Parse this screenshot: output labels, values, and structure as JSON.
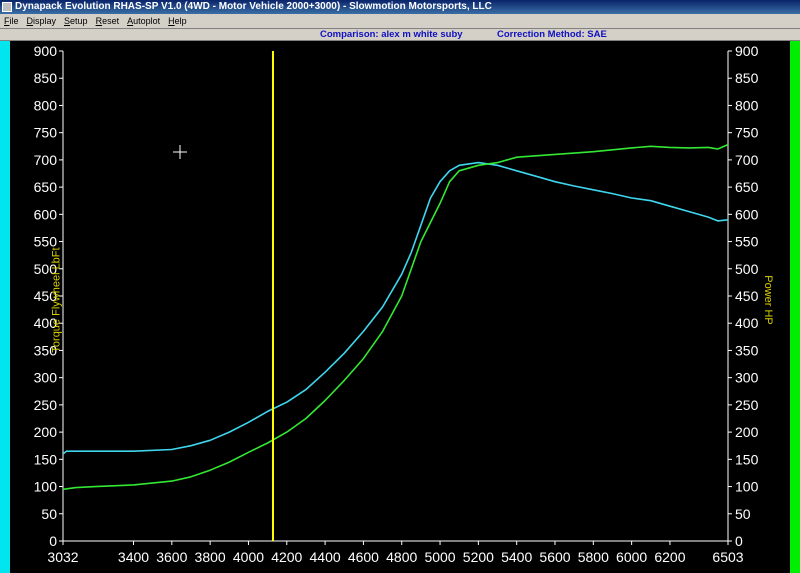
{
  "window": {
    "title": "Dynapack Evolution RHAS-SP V1.0  (4WD - Motor Vehicle 2000+3000) - Slowmotion Motorsports, LLC"
  },
  "menu": {
    "items": [
      "File",
      "Display",
      "Setup",
      "Reset",
      "Autoplot",
      "Help"
    ],
    "underline": [
      "F",
      "D",
      "S",
      "R",
      "A",
      "H"
    ]
  },
  "info": {
    "comparison": "Comparison: alex m white suby",
    "correction": "Correction Method: SAE"
  },
  "colors": {
    "torque": "#3fd6ee",
    "power": "#33e833",
    "cursor": "#ffff00",
    "axis_label": "#d8d000",
    "tick_text": "#ffffff"
  },
  "chart_data": {
    "type": "line",
    "xlabel": "",
    "ylabel_left": "Torque Flywheel LbFt",
    "ylabel_right": "Power HP",
    "xlim": [
      3032,
      6503
    ],
    "ylim": [
      0,
      900
    ],
    "x_ticks": [
      "3032",
      "3400",
      "3600",
      "3800",
      "4000",
      "4200",
      "4400",
      "4600",
      "4800",
      "5000",
      "5200",
      "5400",
      "5600",
      "5800",
      "6000",
      "6200",
      "6503"
    ],
    "y_ticks": [
      "0",
      "50",
      "100",
      "150",
      "200",
      "250",
      "300",
      "350",
      "400",
      "450",
      "500",
      "550",
      "600",
      "650",
      "700",
      "750",
      "800",
      "850",
      "900"
    ],
    "cursor_x": 4128,
    "series": [
      {
        "key": "torque",
        "x": [
          3032,
          3050,
          3200,
          3400,
          3600,
          3700,
          3800,
          3900,
          4000,
          4100,
          4200,
          4300,
          4400,
          4500,
          4600,
          4700,
          4800,
          4850,
          4900,
          4950,
          5000,
          5050,
          5100,
          5200,
          5300,
          5400,
          5500,
          5600,
          5700,
          5800,
          5900,
          6000,
          6100,
          6200,
          6300,
          6400,
          6450,
          6503
        ],
        "values": [
          160,
          165,
          165,
          165,
          168,
          175,
          185,
          200,
          218,
          238,
          255,
          278,
          310,
          345,
          385,
          430,
          490,
          530,
          580,
          630,
          660,
          680,
          690,
          695,
          690,
          680,
          670,
          660,
          652,
          645,
          638,
          630,
          625,
          615,
          605,
          595,
          588,
          590
        ]
      },
      {
        "key": "power",
        "x": [
          3032,
          3100,
          3200,
          3400,
          3600,
          3700,
          3800,
          3900,
          4000,
          4100,
          4200,
          4300,
          4400,
          4500,
          4600,
          4700,
          4800,
          4900,
          5000,
          5050,
          5100,
          5200,
          5300,
          5400,
          5600,
          5800,
          6000,
          6100,
          6200,
          6300,
          6400,
          6450,
          6503
        ],
        "values": [
          95,
          98,
          100,
          103,
          110,
          118,
          130,
          145,
          163,
          180,
          200,
          225,
          258,
          295,
          335,
          385,
          450,
          550,
          620,
          660,
          680,
          690,
          695,
          705,
          710,
          715,
          722,
          725,
          723,
          722,
          723,
          720,
          728
        ]
      }
    ]
  }
}
